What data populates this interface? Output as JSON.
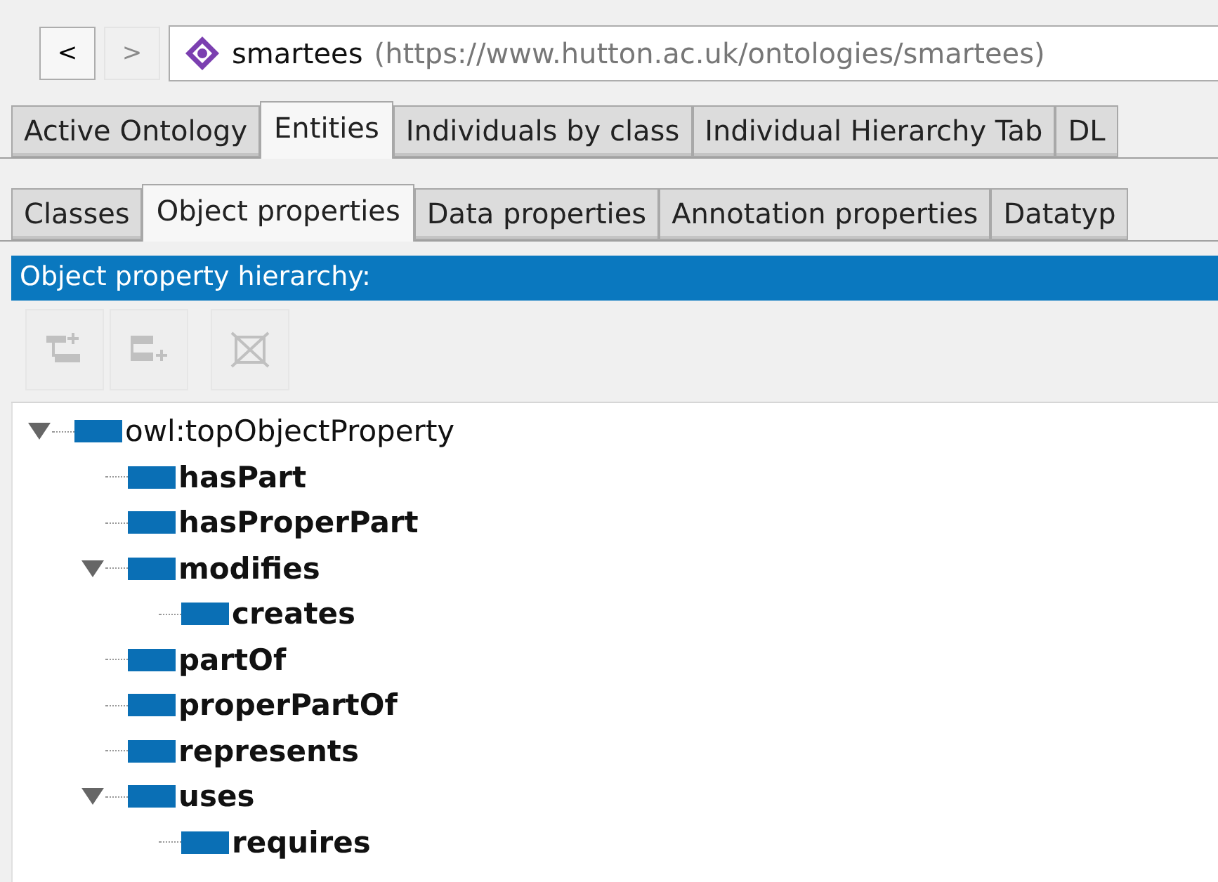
{
  "navigation": {
    "back": {
      "label": "<",
      "disabled": false
    },
    "forward": {
      "label": ">",
      "disabled": true
    }
  },
  "address": {
    "name": "smartees",
    "iri": "(https://www.hutton.ac.uk/ontologies/smartees)"
  },
  "tabs": [
    {
      "label": "Active Ontology",
      "selected": false
    },
    {
      "label": "Entities",
      "selected": true
    },
    {
      "label": "Individuals by class",
      "selected": false
    },
    {
      "label": "Individual Hierarchy Tab",
      "selected": false
    },
    {
      "label": "DL",
      "selected": false
    }
  ],
  "subtabs": [
    {
      "label": "Classes",
      "selected": false
    },
    {
      "label": "Object properties",
      "selected": true
    },
    {
      "label": "Data properties",
      "selected": false
    },
    {
      "label": "Annotation properties",
      "selected": false
    },
    {
      "label": "Datatyp",
      "selected": false
    }
  ],
  "panel": {
    "title": "Object property hierarchy:",
    "toolbar": [
      {
        "kind": "add-sub",
        "disabled": true
      },
      {
        "kind": "add-sibling",
        "disabled": true
      },
      {
        "kind": "delete",
        "disabled": true
      }
    ]
  },
  "tree": [
    {
      "label": "owl:topObjectProperty",
      "bold": false,
      "expanded": true,
      "children": [
        {
          "label": "hasPart",
          "bold": true
        },
        {
          "label": "hasProperPart",
          "bold": true
        },
        {
          "label": "modifies",
          "bold": true,
          "expanded": true,
          "children": [
            {
              "label": "creates",
              "bold": true
            }
          ]
        },
        {
          "label": "partOf",
          "bold": true
        },
        {
          "label": "properPartOf",
          "bold": true
        },
        {
          "label": "represents",
          "bold": true
        },
        {
          "label": "uses",
          "bold": true,
          "expanded": true,
          "children": [
            {
              "label": "requires",
              "bold": true
            }
          ]
        }
      ]
    }
  ]
}
